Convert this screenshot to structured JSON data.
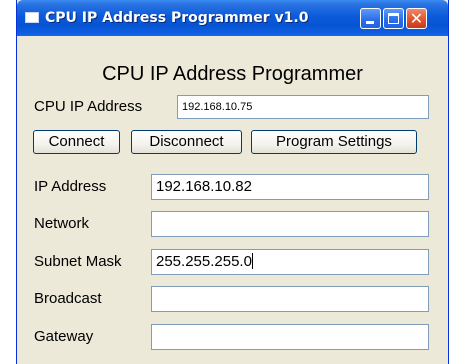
{
  "window": {
    "title": "CPU IP Address Programmer v1.0"
  },
  "heading": "CPU IP Address Programmer",
  "cpu_ip": {
    "label": "CPU IP Address",
    "value": "192.168.10.75"
  },
  "buttons": {
    "connect": "Connect",
    "disconnect": "Disconnect",
    "settings": "Program Settings"
  },
  "fields": {
    "ip_address": {
      "label": "IP Address",
      "value": "192.168.10.82"
    },
    "network": {
      "label": "Network",
      "value": ""
    },
    "subnet_mask": {
      "label": "Subnet Mask",
      "value": "255.255.255.0"
    },
    "broadcast": {
      "label": "Broadcast",
      "value": ""
    },
    "gateway": {
      "label": "Gateway",
      "value": ""
    }
  },
  "icons": [
    "app-window-icon",
    "minimize-icon",
    "maximize-icon",
    "close-icon"
  ],
  "colors": {
    "titlebar": "#0A5BDB",
    "window_bg": "#ECE9D8",
    "close_button": "#E0542F"
  }
}
